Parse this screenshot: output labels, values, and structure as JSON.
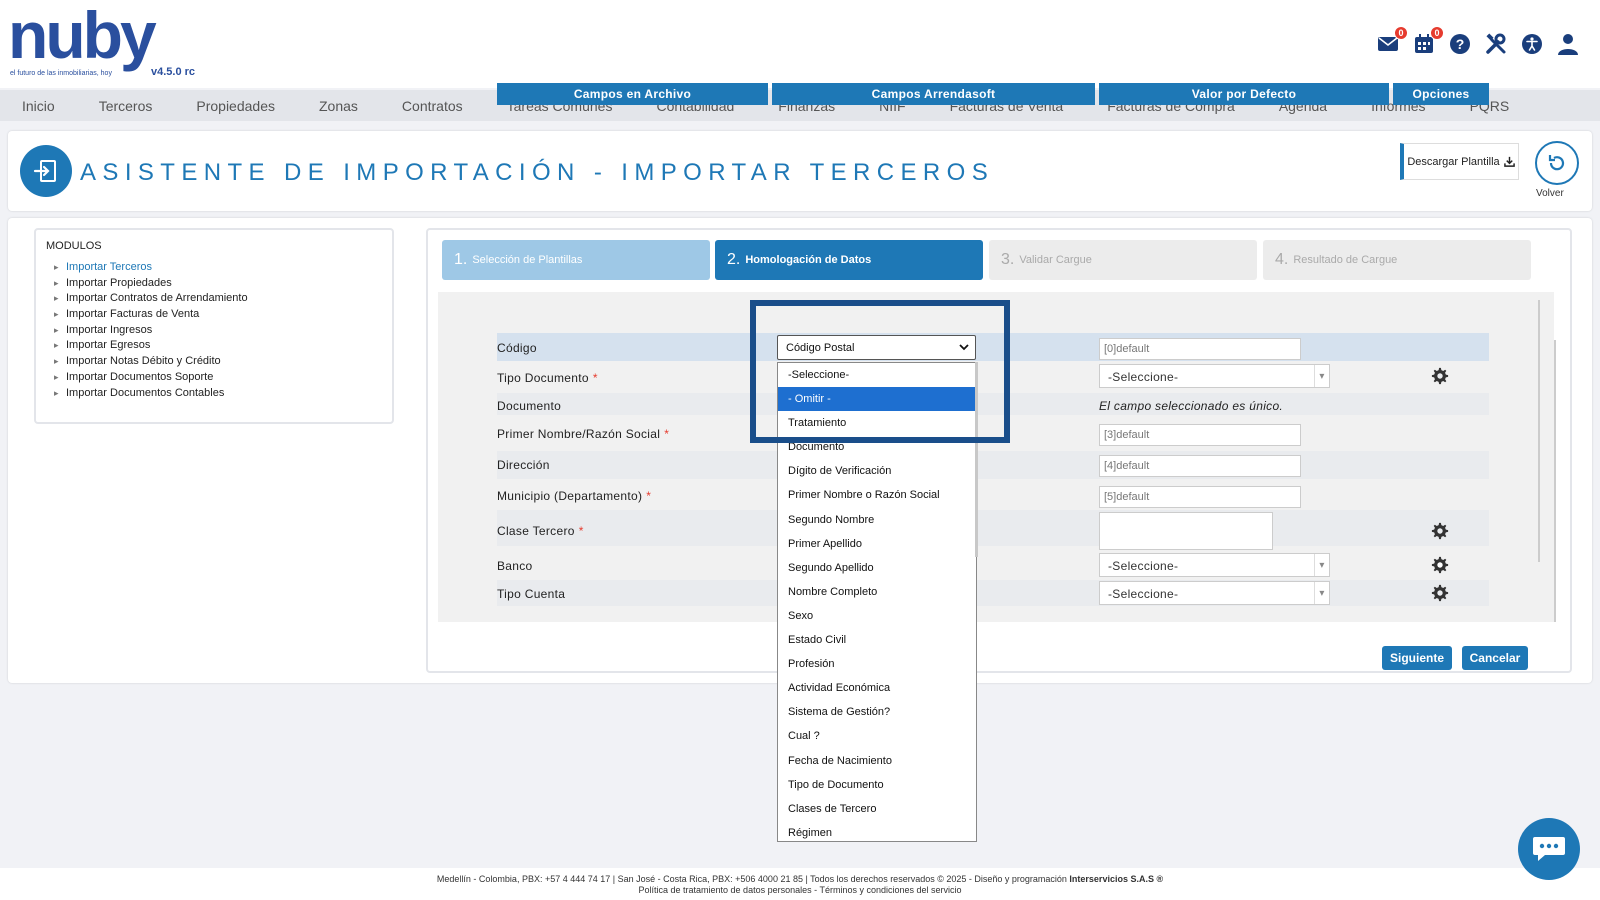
{
  "brand": {
    "logo_text": "nuby",
    "tagline": "el futuro de las inmobiliarias, hoy",
    "version": "v4.5.0 rc"
  },
  "top_icons": [
    {
      "name": "mail-icon",
      "badge": "0"
    },
    {
      "name": "calendar-icon",
      "badge": "0"
    },
    {
      "name": "help-icon"
    },
    {
      "name": "tools-icon"
    },
    {
      "name": "accessibility-icon"
    },
    {
      "name": "user-icon"
    }
  ],
  "nav": [
    "Inicio",
    "Terceros",
    "Propiedades",
    "Zonas",
    "Contratos",
    "Tareas Comunes",
    "Contabilidad",
    "Finanzas",
    "NIIF",
    "Facturas de Venta",
    "Facturas de Compra",
    "Agenda",
    "Informes",
    "PQRS"
  ],
  "page": {
    "title": "ASISTENTE DE IMPORTACIÓN - IMPORTAR TERCEROS",
    "download_label": "Descargar Plantilla",
    "back_label": "Volver"
  },
  "modules": {
    "title": "MODULOS",
    "items": [
      "Importar Terceros",
      "Importar Propiedades",
      "Importar Contratos de Arrendamiento",
      "Importar Facturas de Venta",
      "Importar Ingresos",
      "Importar Egresos",
      "Importar Notas Débito y Crédito",
      "Importar Documentos Soporte",
      "Importar Documentos Contables"
    ],
    "active_index": 0
  },
  "steps": [
    {
      "num": "1.",
      "label": "Selección de Plantillas",
      "state": "done"
    },
    {
      "num": "2.",
      "label": "Homologación de Datos",
      "state": "current"
    },
    {
      "num": "3.",
      "label": "Validar Cargue",
      "state": "pending"
    },
    {
      "num": "4.",
      "label": "Resultado de Cargue",
      "state": "pending"
    }
  ],
  "table": {
    "headers": [
      "Campos en Archivo",
      "Campos Arrendasoft",
      "Valor por Defecto",
      "Opciones"
    ],
    "rows": [
      {
        "label": "Código",
        "required": false,
        "default": "[0]default"
      },
      {
        "label": "Tipo Documento",
        "required": true,
        "select": "-Seleccione-"
      },
      {
        "label": "Documento",
        "required": false,
        "note": "El campo seleccionado es único."
      },
      {
        "label": "Primer Nombre/Razón Social",
        "required": true,
        "default": "[3]default"
      },
      {
        "label": "Dirección",
        "required": false,
        "default": "[4]default"
      },
      {
        "label": "Municipio (Departamento)",
        "required": true,
        "default": "[5]default"
      },
      {
        "label": "Clase Tercero",
        "required": true
      },
      {
        "label": "Banco",
        "required": false,
        "select": "-Seleccione-"
      },
      {
        "label": "Tipo Cuenta",
        "required": false,
        "select": "-Seleccione-"
      }
    ]
  },
  "dropdown": {
    "selected": "Código Postal",
    "highlighted_index": 1,
    "options": [
      "-Seleccione-",
      "- Omitir -",
      "Tratamiento",
      "Documento",
      "Dígito de Verificación",
      "Primer Nombre o Razón Social",
      "Segundo Nombre",
      "Primer Apellido",
      "Segundo Apellido",
      "Nombre Completo",
      "Sexo",
      "Estado Civil",
      "Profesión",
      "Actividad Económica",
      "Sistema de Gestión?",
      "Cual ?",
      "Fecha de Nacimiento",
      "Tipo de Documento",
      "Clases de Tercero",
      "Régimen"
    ]
  },
  "buttons": {
    "next": "Siguiente",
    "cancel": "Cancelar"
  },
  "footer": {
    "line1_prefix": "Medellín - Colombia, PBX: +57 4 444 74 17 | San José - Costa Rica, PBX: +506 4000 21 85 | Todos los derechos reservados © 2025 - Diseño y programación ",
    "line1_company": "Interservicios S.A.S ®",
    "line2": "Política de tratamiento de datos personales - Términos y condiciones del servicio"
  },
  "colors": {
    "primary": "#1e78b6",
    "brand": "#2a4f9e",
    "required": "#e63b2e",
    "highlight": "#1e6fd0",
    "focus_frame": "#1a4e8a"
  }
}
